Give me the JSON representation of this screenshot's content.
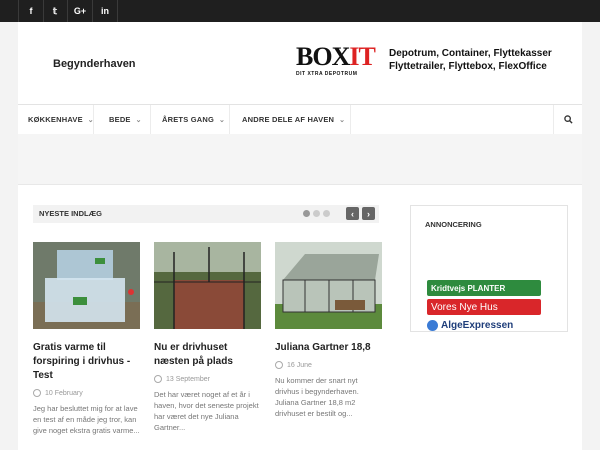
{
  "social": [
    {
      "icon": "facebook-icon",
      "glyph": "f"
    },
    {
      "icon": "twitter-icon",
      "glyph": "𝕥"
    },
    {
      "icon": "google-plus-icon",
      "glyph": "G+"
    },
    {
      "icon": "linkedin-icon",
      "glyph": "in"
    }
  ],
  "header": {
    "site_title": "Begynderhaven",
    "logo_text_a": "BOX",
    "logo_text_b": "IT",
    "logo_tagline": "DIT XTRA DEPOTRUM",
    "promo_line1": "Depotrum, Container, Flyttekasser",
    "promo_line2": "Flyttetrailer, Flyttebox, FlexOffice"
  },
  "nav": {
    "items": [
      {
        "label": "KØKKENHAVE"
      },
      {
        "label": "BEDE"
      },
      {
        "label": "ÅRETS GANG"
      },
      {
        "label": "ANDRE DELE AF HAVEN"
      }
    ],
    "search_icon": "search-icon"
  },
  "latest": {
    "heading": "NYESTE INDLÆG",
    "prev": "‹",
    "next": "›"
  },
  "posts": [
    {
      "title": "Gratis varme til forspiring i drivhus - Test",
      "date": "10 February",
      "excerpt": "Jeg har besluttet mig for at lave en test af en måde jeg tror, kan give noget ekstra gratis varme..."
    },
    {
      "title": "Nu er drivhuset næsten på plads",
      "date": "13 September",
      "excerpt": "Det har været noget af et år i haven, hvor det seneste projekt har været det nye Juliana Gartner..."
    },
    {
      "title": "Juliana Gartner 18,8",
      "date": "16 June",
      "excerpt": "Nu kommer der snart nyt drivhus i begynderhaven. Juliana Gartner 18,8 m2 drivhuset er bestilt og..."
    }
  ],
  "ads": {
    "heading": "ANNONCERING",
    "ad1": "Kridtvejs PLANTER",
    "ad2": "Vores Nye Hus",
    "ad3": "AlgeExpressen"
  },
  "colors": {
    "topbar": "#1f1f1f",
    "ad_green": "#2e8b3e",
    "ad_red": "#d9262a",
    "ad_blue": "#1e3d7a"
  }
}
